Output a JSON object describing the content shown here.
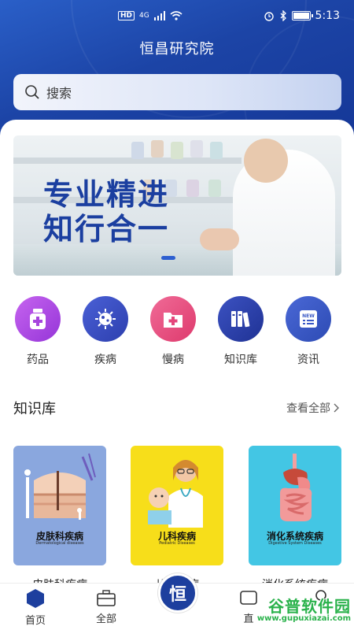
{
  "status_bar": {
    "hd": "HD",
    "network": "4G",
    "time": "5:13"
  },
  "header": {
    "title": "恒昌研究院"
  },
  "search": {
    "placeholder": "搜索"
  },
  "banner": {
    "line1": "专业精进",
    "line2": "知行合一"
  },
  "categories": [
    {
      "label": "药品",
      "icon": "medicine-bottle-icon",
      "color": "#b04ee6"
    },
    {
      "label": "疾病",
      "icon": "virus-icon",
      "color": "#3a4fc4"
    },
    {
      "label": "慢病",
      "icon": "medical-folder-icon",
      "color": "#e9457e"
    },
    {
      "label": "知识库",
      "icon": "books-icon",
      "color": "#2c3fa0"
    },
    {
      "label": "资讯",
      "icon": "news-icon",
      "color": "#3a59c6"
    }
  ],
  "knowledge": {
    "title": "知识库",
    "more": "查看全部",
    "cards": [
      {
        "title": "皮肤科疾病",
        "subtitle": "Dermatological diseases",
        "caption": "皮肤科疾病",
        "bg": "#8aa7de"
      },
      {
        "title": "儿科疾病",
        "subtitle": "Pediatric Diseases",
        "caption": "儿科疾病",
        "bg": "#f7de1a"
      },
      {
        "title": "消化系统疾病",
        "subtitle": "Digestive System Diseases",
        "caption": "消化系统疾病",
        "bg": "#43c6e4"
      }
    ]
  },
  "tabbar": {
    "home": "首页",
    "all": "全部",
    "center": "恒",
    "live": "直",
    "mine": ""
  },
  "watermark": {
    "main": "谷普软件园",
    "url": "www.gupuxiazai.com"
  }
}
